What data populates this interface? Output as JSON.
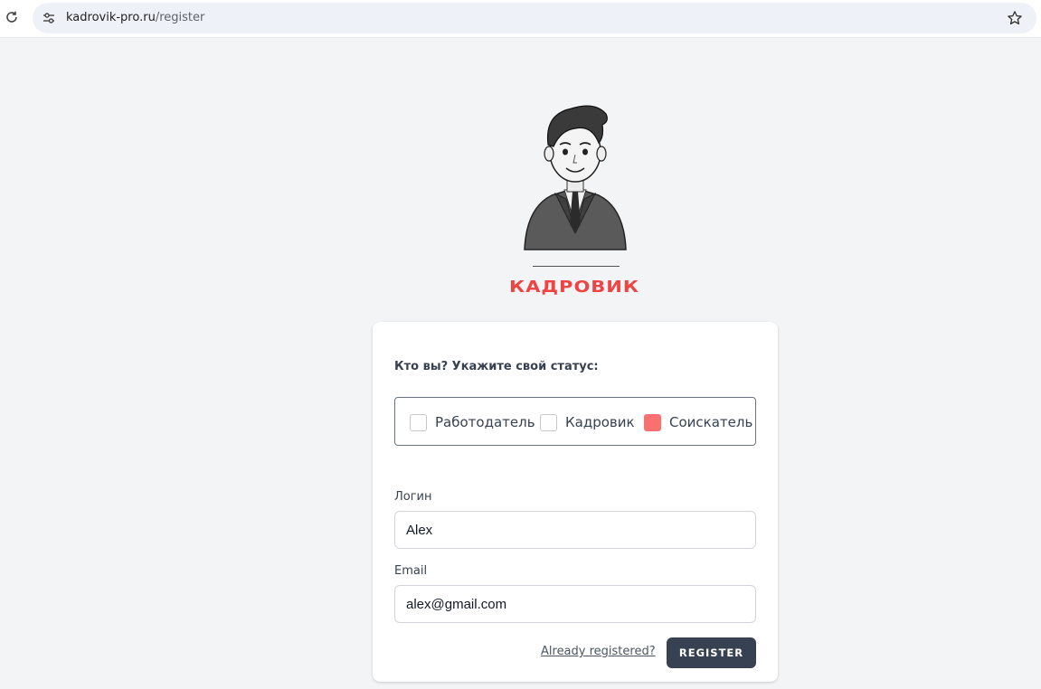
{
  "browser": {
    "url_host": "kadrovik-pro.ru",
    "url_path": "/register"
  },
  "brand": {
    "name": "КАДРОВИК",
    "color": "#ef4444"
  },
  "form": {
    "status_question": "Кто вы? Укажите свой статус:",
    "status_options": [
      {
        "label": "Работодатель",
        "checked": false
      },
      {
        "label": "Кадровик",
        "checked": false
      },
      {
        "label": "Соискатель",
        "checked": true
      }
    ],
    "login": {
      "label": "Логин",
      "value": "Alex"
    },
    "email": {
      "label": "Email",
      "value": "alex@gmail.com"
    },
    "already_registered": "Already registered?",
    "submit_label": "REGISTER"
  },
  "colors": {
    "background": "#f3f4f6",
    "checked": "#f87171",
    "button": "#374151"
  },
  "icons": [
    "reload-icon",
    "site-info-icon",
    "star-icon"
  ]
}
